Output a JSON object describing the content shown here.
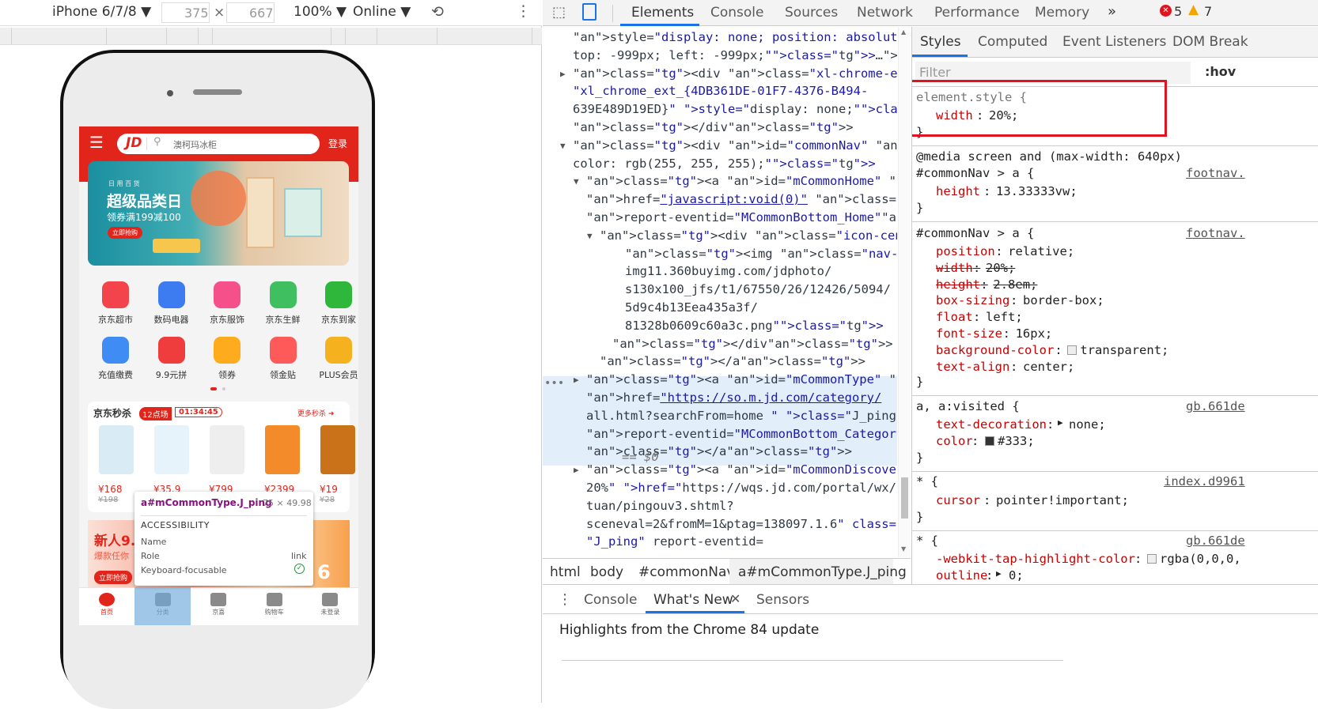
{
  "device": {
    "name": "iPhone 6/7/8",
    "width": "375",
    "height": "667",
    "zoom": "100%",
    "network": "Online"
  },
  "phone": {
    "login": "登录",
    "search_placeholder": "澳柯玛冰柜",
    "logo": "JD",
    "banner": {
      "small": "日 用 百 货",
      "title": "超级品类日",
      "sub": "领券满199减100",
      "btn": "立即抢购"
    },
    "grid": [
      {
        "label": "京东超市",
        "color": "#f2444a"
      },
      {
        "label": "数码电器",
        "color": "#3d7cf0"
      },
      {
        "label": "京东服饰",
        "color": "#f6508a"
      },
      {
        "label": "京东生鲜",
        "color": "#3fbf5f"
      },
      {
        "label": "京东到家",
        "color": "#2fb73c"
      },
      {
        "label": "充值缴费",
        "color": "#3f8cf5"
      },
      {
        "label": "9.9元拼",
        "color": "#ef3c3c"
      },
      {
        "label": "领券",
        "color": "#ffab1e"
      },
      {
        "label": "领金贴",
        "color": "#ff5a5a"
      },
      {
        "label": "PLUS会员",
        "color": "#f6b21e"
      }
    ],
    "seckill": {
      "title": "京东秒杀",
      "session": "12点场",
      "time": "01:34:45",
      "more": "更多秒杀",
      "items": [
        {
          "price": "¥168",
          "old": "¥198"
        },
        {
          "price": "¥35.9",
          "old": ""
        },
        {
          "price": "¥799",
          "old": ""
        },
        {
          "price": "¥2399",
          "old": ""
        },
        {
          "price": "¥19",
          "old": "¥28"
        }
      ]
    },
    "newuser": {
      "title": "新人9.",
      "sub": "爆款任你",
      "btn": "立即抢购",
      "badge": "6"
    },
    "nav": [
      {
        "label": "首页",
        "icon": "home-icon"
      },
      {
        "label": "分类",
        "icon": "category-icon"
      },
      {
        "label": "京喜",
        "icon": "jingxi-icon"
      },
      {
        "label": "购物车",
        "icon": "cart-icon"
      },
      {
        "label": "未登录",
        "icon": "user-icon"
      }
    ]
  },
  "tooltip": {
    "selector": "a#mCommonType.J_ping",
    "size": "75 × 49.98",
    "section": "ACCESSIBILITY",
    "rows": [
      {
        "k": "Name",
        "v": ""
      },
      {
        "k": "Role",
        "v": "link"
      },
      {
        "k": "Keyboard-focusable",
        "v": ""
      }
    ]
  },
  "devtools": {
    "tabs": [
      "Elements",
      "Console",
      "Sources",
      "Network",
      "Performance",
      "Memory"
    ],
    "errors": "5",
    "warnings": "7",
    "sidetabs": [
      "Styles",
      "Computed",
      "Event Listeners",
      "DOM Break"
    ],
    "filter_placeholder": "Filter",
    "hov": ":hov",
    "breadcrumbs": [
      "html",
      "body",
      "#commonNav",
      "a#mCommonType.J_ping"
    ],
    "drawer_tabs": [
      "Console",
      "What's New",
      "Sensors"
    ],
    "drawer_text": "Highlights from the Chrome 84 update",
    "dollar0": "== $0"
  },
  "dom_lines": [
    "style=\"display: none; position: absolute;",
    "top: -999px; left: -999px;\">…</iframe>",
    "<div class=\"xl-chrome-ext-bar\" id=",
    "\"xl_chrome_ext_{4DB361DE-01F7-4376-B494-",
    "639E489D19ED}\" style=\"display: none;\">…",
    "</div>",
    "<div id=\"commonNav\" style=\"background-",
    "color: rgb(255, 255, 255);\">",
    "<a id=\"mCommonHome\" style=\"width: 20%\"",
    "href=\"javascript:void(0)\" class=\"J_ping\"",
    "report-eventid=\"MCommonBottom_Home\">",
    "<div class=\"icon-center\">",
    "<img class=\"nav-img\" src=\"https://",
    "img11.360buyimg.com/jdphoto/",
    "s130x100_jfs/t1/67550/26/12426/5094/",
    "5d9c4b13Eea435a3f/",
    "81328b0609c60a3c.png\">",
    "</div>",
    "</a>",
    "<a id=\"mCommonType\" style=\"width: 20%\"",
    "href=\"https://so.m.jd.com/category/",
    "all.html?searchFrom=home \" class=\"J_ping\"",
    "report-eventid=\"MCommonBottom_Category\">…",
    "</a>",
    "<a id=\"mCommonDiscover\" style=\"width:",
    "20%\" href=\"https://wqs.jd.com/portal/wx/",
    "tuan/pingouv3.shtml?",
    "sceneval=2&fromM=1&ptag=138097.1.6\" class=",
    "\"J_ping\" report-eventid="
  ],
  "styles": {
    "el_selector": "element.style {",
    "el_prop": "width",
    "el_val": "20%;",
    "r1_media": "@media screen and (max-width: 640px)",
    "r1_sel": "#commonNav > a {",
    "r1_src": "footnav.",
    "r1_prop": "height",
    "r1_val": "13.33333vw;",
    "r2_sel": "#commonNav > a {",
    "r2_src": "footnav.",
    "r2_props": [
      {
        "p": "position",
        "v": "relative;",
        "strike": false
      },
      {
        "p": "width",
        "v": "20%;",
        "strike": true
      },
      {
        "p": "height",
        "v": "2.8em;",
        "strike": true
      },
      {
        "p": "box-sizing",
        "v": "border-box;",
        "strike": false
      },
      {
        "p": "float",
        "v": "left;",
        "strike": false
      },
      {
        "p": "font-size",
        "v": "16px;",
        "strike": false
      },
      {
        "p": "background-color",
        "v": "transparent;",
        "strike": false
      },
      {
        "p": "text-align",
        "v": "center;",
        "strike": false
      }
    ],
    "r3_sel": "a, a:visited {",
    "r3_src": "gb.661de",
    "r3_p1": "text-decoration",
    "r3_v1": "none;",
    "r3_p2": "color",
    "r3_v2": "#333;",
    "r4_sel": "* {",
    "r4_src": "index.d9961",
    "r4_p": "cursor",
    "r4_v": "pointer!important;",
    "r5_sel": "* {",
    "r5_src": "gb.661de",
    "r5_p1": "-webkit-tap-highlight-color",
    "r5_v1": "rgba(0,0,0,",
    "r5_p2": "outline",
    "r5_v2": "0;"
  },
  "colors": {
    "jd_red": "#e1251b",
    "highlight_row": "#e3eefb",
    "select_blue": "#1a73e8",
    "annotation_red": "#e0141e"
  }
}
